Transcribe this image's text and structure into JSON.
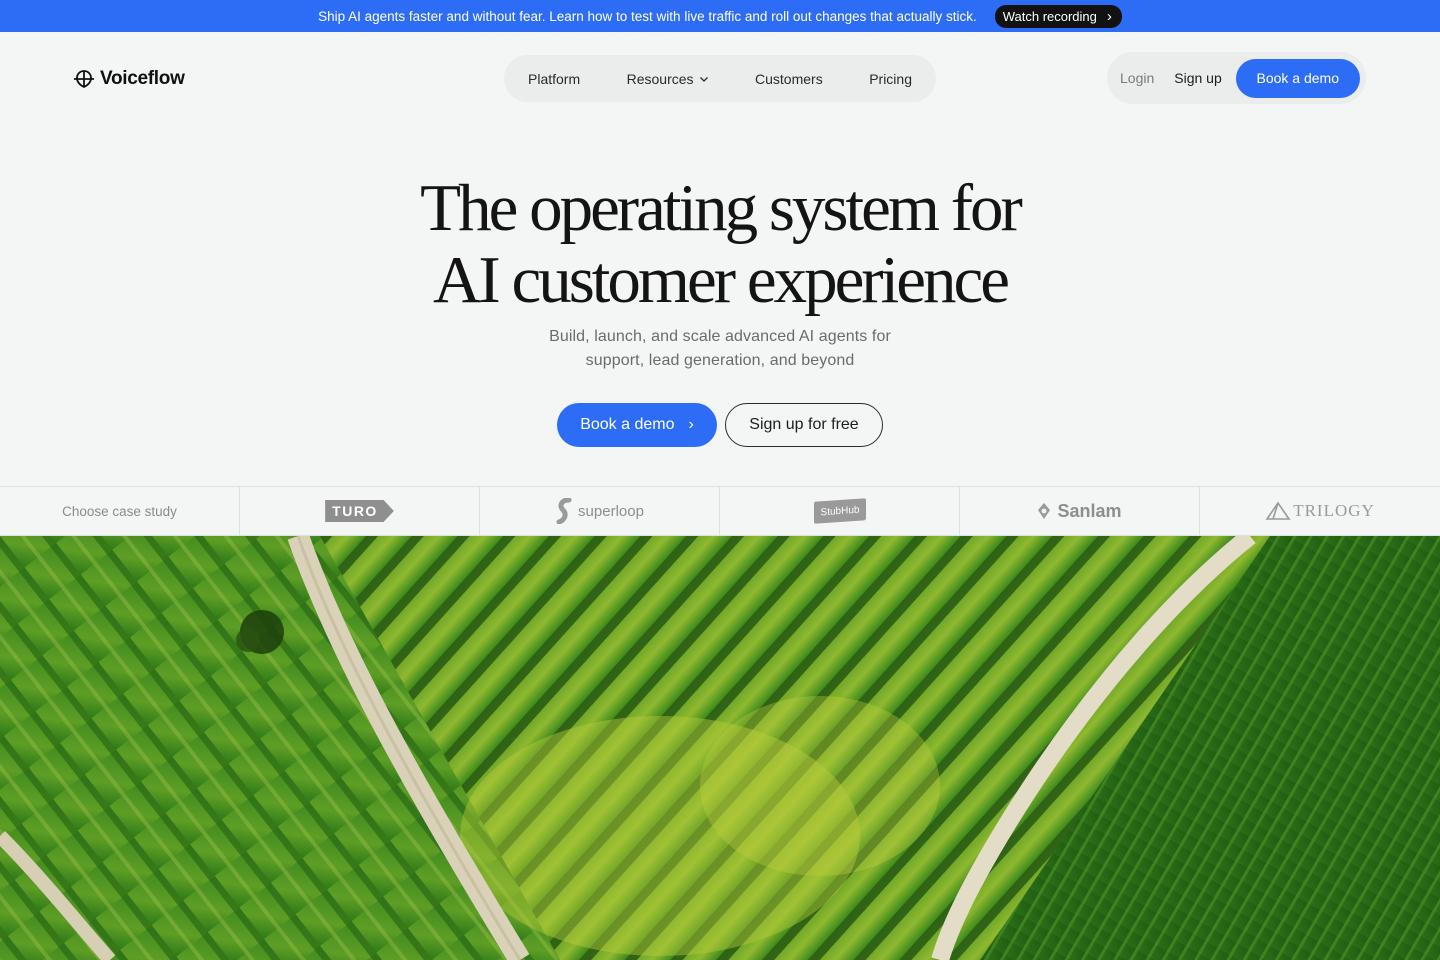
{
  "announcement": {
    "text": "Ship AI agents faster and without fear. Learn how to test with live traffic and roll out changes that actually stick.",
    "button_label": "Watch recording",
    "accent": "#2d6df6"
  },
  "header": {
    "brand": "Voiceflow",
    "nav": [
      {
        "label": "Platform"
      },
      {
        "label": "Resources"
      },
      {
        "label": "Customers"
      },
      {
        "label": "Pricing"
      }
    ],
    "login": "Login",
    "signup": "Sign up",
    "book_demo": "Book a demo"
  },
  "hero": {
    "title_line1": "The operating system for",
    "title_line2": "AI customer experience",
    "subtitle_line1": "Build, launch, and scale advanced AI agents for",
    "subtitle_line2": "support, lead generation, and beyond",
    "cta_primary": "Book a demo",
    "cta_secondary": "Sign up for free"
  },
  "case_studies": {
    "label": "Choose case study",
    "logos": [
      {
        "name": "turo",
        "text": "TURO"
      },
      {
        "name": "superloop",
        "text": "superloop"
      },
      {
        "name": "stubhub",
        "text": "StubHub"
      },
      {
        "name": "sanlam",
        "text": "Sanlam"
      },
      {
        "name": "trilogy",
        "text": "TRILOGY"
      }
    ]
  },
  "colors": {
    "primary": "#2d6df6",
    "background": "#f4f5f5",
    "field_green": "#3f8a1c"
  },
  "icons": [
    "voiceflow-logo-icon",
    "chevron-right-icon",
    "chevron-down-icon",
    "superloop-icon",
    "sanlam-icon",
    "trilogy-icon"
  ]
}
